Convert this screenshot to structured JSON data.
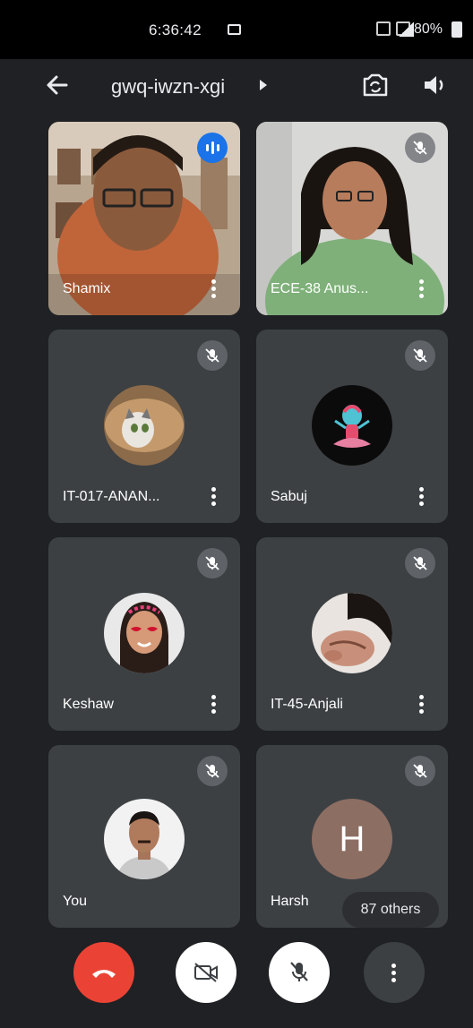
{
  "status_bar": {
    "time": "6:36:42",
    "battery": "80%"
  },
  "app_bar": {
    "meeting_code": "gwq-iwzn-xgi"
  },
  "participants": [
    {
      "name": "Shamix",
      "speaking": true
    },
    {
      "name": "ECE-38 Anus...",
      "muted": true
    },
    {
      "name": "IT-017-ANAN...",
      "muted": true
    },
    {
      "name": "Sabuj",
      "muted": true
    },
    {
      "name": "Keshaw",
      "muted": true
    },
    {
      "name": "IT-45-Anjali",
      "muted": true
    },
    {
      "name": "You",
      "muted": true
    },
    {
      "name": "Harsh",
      "muted": true,
      "initial": "H",
      "avatar_color": "#8d6e63"
    }
  ],
  "others_chip": "87 others",
  "colors": {
    "background": "#202124",
    "tile": "#3c4043",
    "end_call": "#ea4335",
    "speaking": "#1a73e8"
  }
}
